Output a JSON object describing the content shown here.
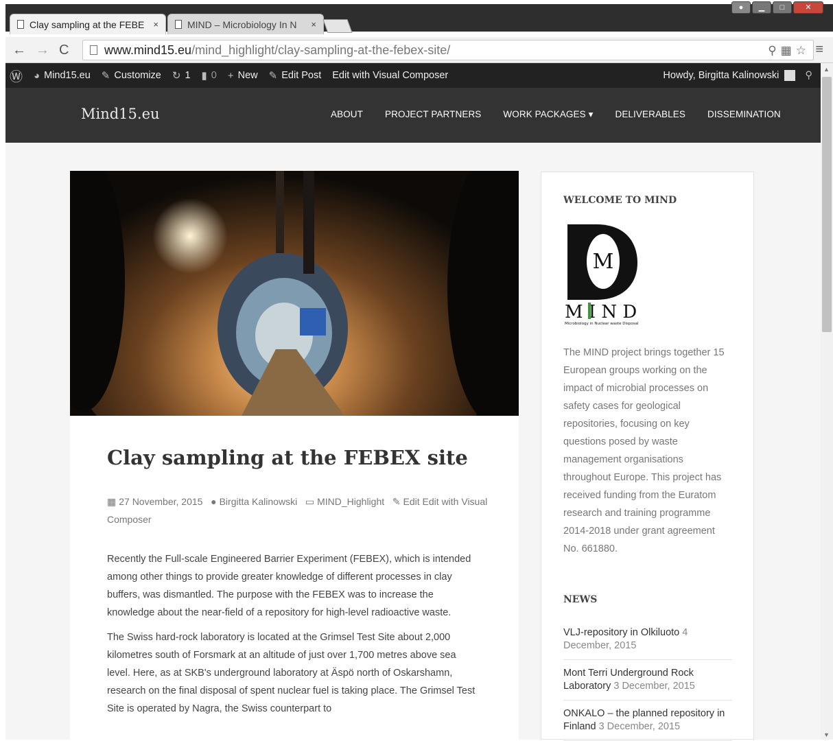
{
  "browser": {
    "tabs": [
      {
        "label": "Clay sampling at the FEBE",
        "close": "×"
      },
      {
        "label": "MIND – Microbiology In N",
        "close": "×"
      }
    ],
    "window_buttons": [
      "▁",
      "□",
      "✕"
    ],
    "url_host": "www.mind15.eu",
    "url_path": "/mind_highlight/clay-sampling-at-the-febex-site/"
  },
  "adminbar": {
    "site": "Mind15.eu",
    "customize": "Customize",
    "updates_count": "1",
    "comments_count": "0",
    "new_label": "New",
    "edit_post": "Edit Post",
    "edit_visual": "Edit with Visual Composer",
    "howdy": "Howdy, Birgitta Kalinowski"
  },
  "header": {
    "site_title": "Mind15.eu",
    "nav": [
      "ABOUT",
      "PROJECT PARTNERS",
      "WORK PACKAGES ▾",
      "DELIVERABLES",
      "DISSEMINATION"
    ]
  },
  "post": {
    "title": "Clay sampling at the FEBEX site",
    "date": "27 November, 2015",
    "author": "Birgitta Kalinowski",
    "category": "MIND_Highlight",
    "edit": "Edit Edit with Visual Composer",
    "paragraphs": [
      "Recently the Full-scale Engineered Barrier Experiment (FEBEX), which is intended among other things to provide greater knowledge of different processes in clay buffers, was dismantled. The purpose with the FEBEX was to increase the knowledge about the near-field of a repository for high-level radioactive waste.",
      "The Swiss hard-rock laboratory is located at the Grimsel Test Site about 2,000 kilometres south of Forsmark at an altitude of just over 1,700 metres above sea level. Here, as at SKB's underground laboratory at Äspö north of Oskarshamn, research on the final disposal of spent nuclear fuel is taking place. The Grimsel Test Site is operated by Nagra, the Swiss counterpart to"
    ]
  },
  "sidebar": {
    "welcome_title": "WELCOME TO MIND",
    "logo_letter": "M",
    "logo_word": "M I N D",
    "logo_tagline": "Microbiology in Nuclear waste Disposal",
    "welcome_text": "The MIND project brings together 15 European groups working on the impact of microbial processes on safety cases for geological repositories, focusing on key questions posed by waste management organisations throughout Europe. This project has received funding from the Euratom research and training programme 2014-2018 under grant agreement No. 661880.",
    "news_title": "NEWS",
    "news": [
      {
        "title": "VLJ-repository in Olkiluoto",
        "date": "4 December, 2015"
      },
      {
        "title": "Mont Terri Underground Rock Laboratory",
        "date": "3 December, 2015"
      },
      {
        "title": "ONKALO – the planned repository in Finland",
        "date": "3 December, 2015"
      }
    ]
  },
  "colors": {
    "adminbar": "#222222",
    "header": "#333333",
    "page_bg": "#f5f5f5",
    "text": "#444444"
  }
}
